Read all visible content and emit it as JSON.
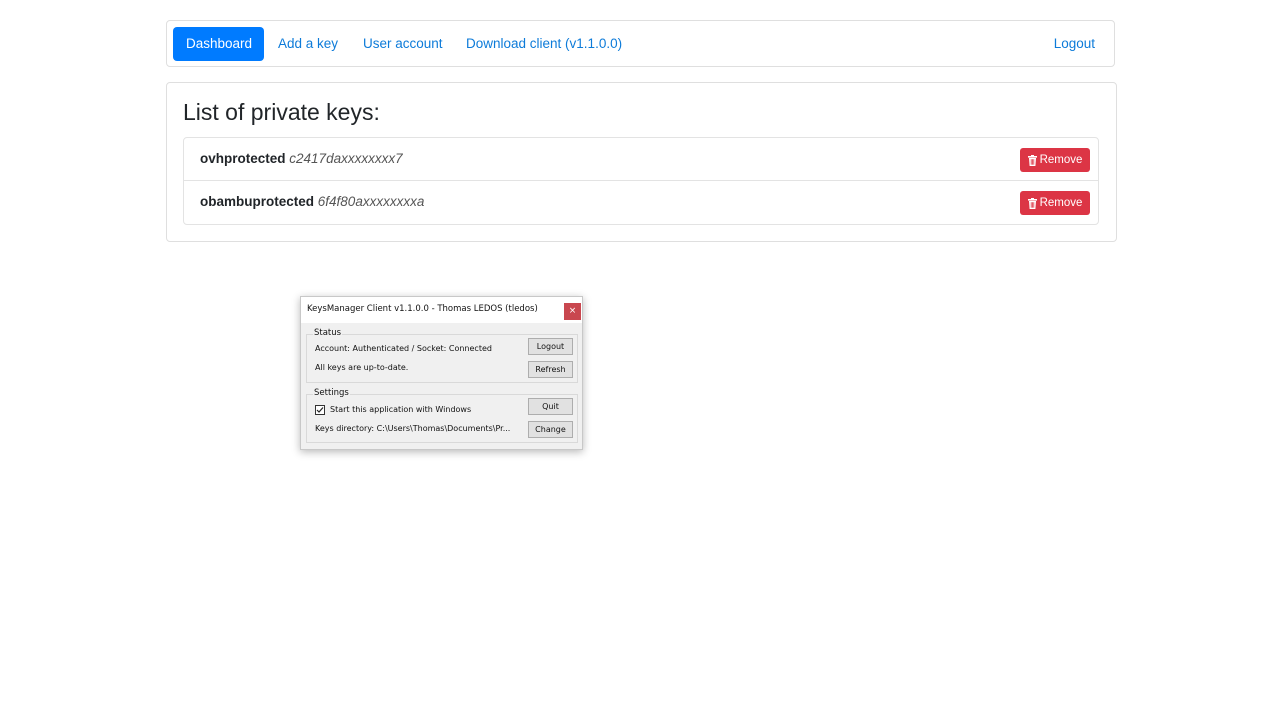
{
  "nav": {
    "dashboard": "Dashboard",
    "add_key": "Add a key",
    "user_account": "User account",
    "download_client": "Download client (v1.1.0.0)",
    "logout": "Logout"
  },
  "keys_panel": {
    "title": "List of private keys:",
    "remove_label": "Remove",
    "keys": [
      {
        "name": "ovhprotected",
        "id": "c2417daxxxxxxxx7"
      },
      {
        "name": "obambuprotected",
        "id": "6f4f80axxxxxxxxa"
      }
    ]
  },
  "client_window": {
    "title": "KeysManager Client v1.1.0.0 - Thomas LEDOS (tledos)",
    "close_glyph": "×",
    "status": {
      "legend": "Status",
      "account_text": "Account: Authenticated / Socket: Connected",
      "keys_text": "All keys are up-to-date.",
      "logout_button": "Logout",
      "refresh_button": "Refresh"
    },
    "settings": {
      "legend": "Settings",
      "startup_label": "Start this application with Windows",
      "startup_checked": true,
      "directory_text": "Keys directory: C:\\Users\\Thomas\\Documents\\Pr...",
      "quit_button": "Quit",
      "change_button": "Change"
    }
  },
  "colors": {
    "primary": "#007bff",
    "link": "#0d7bd9",
    "danger": "#dc3545",
    "close_button": "#c9474f"
  }
}
